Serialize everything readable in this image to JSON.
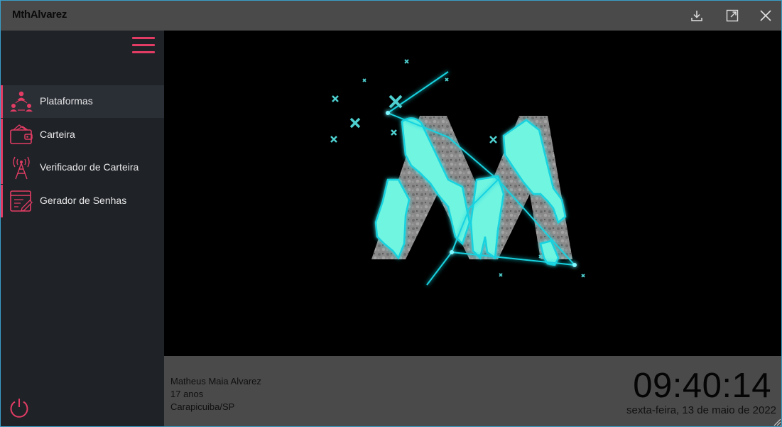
{
  "app": {
    "title": "MthAlvarez"
  },
  "titlebar": {
    "buttons": [
      {
        "name": "download-button",
        "icon": "download-icon"
      },
      {
        "name": "maximize-button",
        "icon": "maximize-icon"
      },
      {
        "name": "close-button",
        "icon": "close-icon"
      }
    ]
  },
  "sidebar": {
    "menu_icon": "hamburger-icon",
    "items": [
      {
        "label": "Plataformas",
        "icon": "users-network-icon",
        "active": true
      },
      {
        "label": "Carteira",
        "icon": "wallet-icon",
        "active": false
      },
      {
        "label": "Verificador de Carteira",
        "icon": "antenna-tower-icon",
        "active": false
      },
      {
        "label": "Gerador de Senhas",
        "icon": "edit-form-icon",
        "active": false
      }
    ],
    "power_icon": "power-icon"
  },
  "main": {
    "logo": "mthalvarez-m-logo"
  },
  "footer": {
    "name": "Matheus Maia Alvarez",
    "age": "17 anos",
    "location": "Carapicuiba/SP",
    "time": "09:40:14",
    "date": "sexta-feira, 13 de maio de 2022"
  },
  "colors": {
    "accent": "#e23c64",
    "titlebar": "#4a4a4a",
    "sidebar": "#1f2227",
    "sidebar_active": "#2a2e35",
    "logo_cyan": "#6ff5e0",
    "logo_line": "#19d3e0"
  }
}
